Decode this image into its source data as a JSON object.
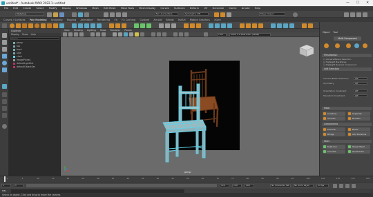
{
  "window": {
    "title": "untitled* - Autodesk MAYA 2022.1: untitled",
    "controls": [
      "—",
      "☐",
      "✕"
    ]
  },
  "menus": [
    "File",
    "Edit",
    "Create",
    "Select",
    "Modify",
    "Display",
    "Windows",
    "Mesh",
    "Edit Mesh",
    "Mesh Tools",
    "Mesh Display",
    "Curves",
    "Surfaces",
    "Deform",
    "UV",
    "Generate",
    "Cache",
    "Arnold",
    "Help"
  ],
  "status": {
    "workspace_label": "Modeling",
    "no_live_surface": "No Live Surface",
    "symmetry_label": "Symmetry: Off",
    "workspace_value": "Maya Classic"
  },
  "shelf_tabs": [
    "Curves / Surfaces",
    "Poly Modeling",
    "Sculpting",
    "Rigging",
    "Animation",
    "Rendering",
    "FX",
    "FX Caching",
    "Custom",
    "Arnold",
    "Bifrost",
    "MASH",
    "Motion Graphics",
    "XGen"
  ],
  "outliner": {
    "title": "Outliner",
    "menus": [
      "Display",
      "Show",
      "Help"
    ],
    "search_placeholder": "Search...",
    "items": [
      "persp",
      "top",
      "front",
      "side",
      "chair",
      "imagePlane1",
      "defaultLightSet",
      "defaultObjectSet"
    ]
  },
  "viewport": {
    "menus": [
      "View",
      "Shading",
      "Lighting",
      "Show",
      "Renderer",
      "Panels"
    ],
    "gamma_value": "1.00",
    "colorspace_value": "ACES 1.0 SDR-video (sRGB)",
    "camera_label": "persp"
  },
  "attribute_editor": {
    "tabs": [
      "Object",
      "Tool"
    ],
    "tool_title": "Multi-Component",
    "sections": {
      "preselection": "Preselection",
      "soft_selection": "Soft Selection",
      "mesh": "Mesh",
      "components": "Components",
      "tools": "Tools"
    },
    "options": [
      "Camera-Based Selection",
      "Highlight Backfaces",
      "Highlight Nearest Component"
    ],
    "option_rows": [
      "Camera-Based Selection",
      "Symmetry",
      "Orientation Constraint",
      "Transform Constraint"
    ],
    "option_values": [
      "Off",
      "Off",
      "Off",
      "Off"
    ],
    "mesh_buttons": [
      "Combine",
      "Separate",
      "Smooth",
      "Boolean"
    ],
    "component_buttons": [
      "Extrude",
      "Bevel",
      "Bridge",
      "Add Divisions"
    ],
    "tool_buttons": [
      "Multi-Cut",
      "Target Weld",
      "Connect",
      "Quad Draw"
    ]
  },
  "timeline": {
    "ticks": [
      "1",
      "5",
      "10",
      "15",
      "20",
      "25",
      "30",
      "35",
      "40",
      "45",
      "50",
      "55",
      "60",
      "65",
      "70",
      "75",
      "80",
      "85",
      "90",
      "95",
      "100",
      "105",
      "110",
      "115",
      "120"
    ],
    "current_frame": "1"
  },
  "range": {
    "start": "1",
    "start_inner": "1",
    "end_inner": "120",
    "end": "120",
    "end2": "200",
    "character_set": "No Character Set",
    "anim_layer": "No Anim Layer",
    "fps": "24 fps"
  },
  "cmdline": {
    "label": "MEL"
  },
  "helpline": {
    "text": "Select an object. Click and drag to move the camera."
  },
  "colors": {
    "accent_orange": "#d08a2c",
    "wire_cyan": "#5fd0e6",
    "viewport_bg": "#6b6b6b",
    "panel_dark": "#2b2b2b"
  }
}
